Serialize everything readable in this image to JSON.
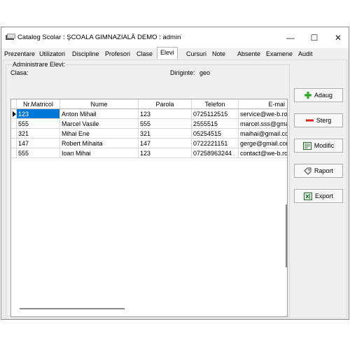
{
  "window": {
    "title": "Catalog Scolar : ŞCOALA GIMNAZIALĂ DEMO : admin",
    "controls": {
      "minimize": "—",
      "maximize": "☐",
      "close": "✕"
    }
  },
  "tabs": [
    {
      "label": "Prezentare"
    },
    {
      "label": "Utilizatori"
    },
    {
      "label": "Discipline"
    },
    {
      "label": "Profesori"
    },
    {
      "label": "Clase"
    },
    {
      "label": "Elevi"
    },
    {
      "label": "Cursuri"
    },
    {
      "label": "Note"
    },
    {
      "label": "Absente"
    },
    {
      "label": "Examene"
    },
    {
      "label": "Audit"
    }
  ],
  "active_tab": "Elevi",
  "panel": {
    "group_title": "Administrare Elevi:",
    "clasa_label": "Clasa:",
    "diriginte_label": "Diriginte:",
    "diriginte_value": "geo"
  },
  "grid": {
    "columns": [
      "Nr.Matricol",
      "Nume",
      "Parola",
      "Telefon",
      "E-mai"
    ],
    "rows": [
      [
        "123",
        "Anton Mihail",
        "123",
        "0725112515",
        "service@we-b.ro"
      ],
      [
        "555",
        "Marcel Vasile",
        "555",
        "2555515",
        "marcel.sss@gmail.com"
      ],
      [
        "321",
        "Mihai Ene",
        "321",
        "05254515",
        "maihai@gmail.com"
      ],
      [
        "147",
        "Robert Mihaita",
        "147",
        "0722221151",
        "gerge@gmail.com"
      ],
      [
        "555",
        "Ioan Mihai",
        "123",
        "07258963244",
        "contact@we-b.ro"
      ]
    ],
    "selected_row": 0
  },
  "buttons": {
    "adaug": "Adaug",
    "sterg": "Sterg",
    "modific": "Modific",
    "raport": "Raport",
    "export": "Export"
  },
  "colors": {
    "selection": "#0078d7",
    "add_icon": "#2eaa2e",
    "delete_icon": "#e02020"
  }
}
